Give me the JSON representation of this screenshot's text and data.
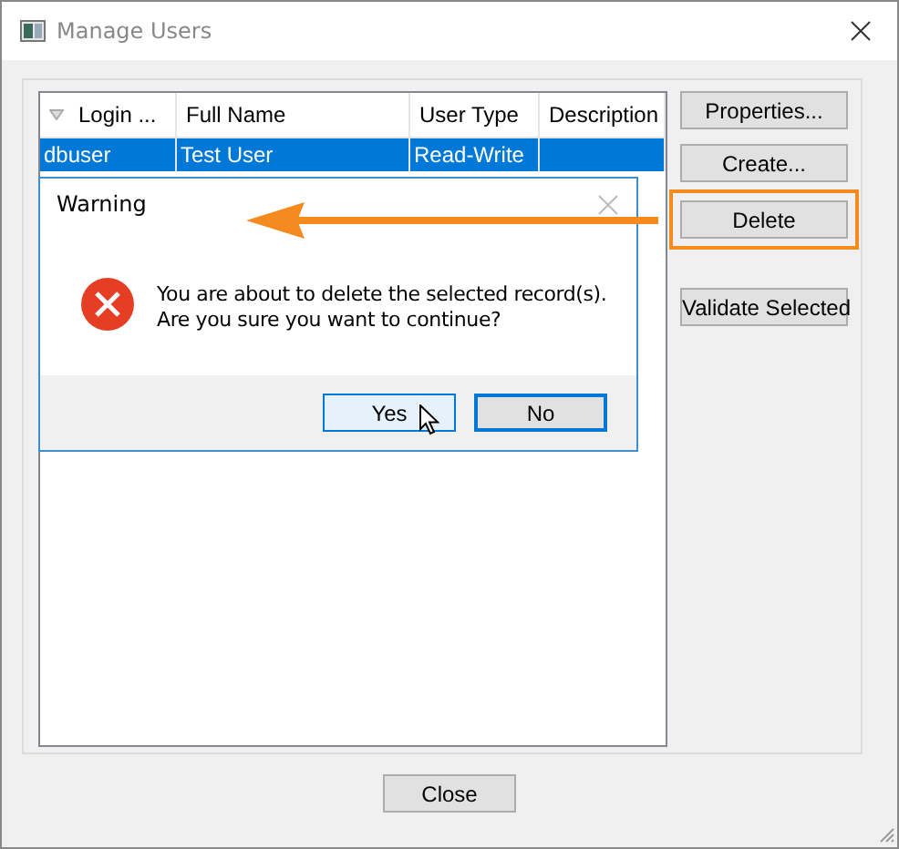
{
  "window": {
    "title": "Manage Users"
  },
  "table": {
    "columns": [
      {
        "label": "Login ...",
        "sort_icon": true
      },
      {
        "label": "Full Name",
        "sort_icon": false
      },
      {
        "label": "User Type",
        "sort_icon": false
      },
      {
        "label": "Description",
        "sort_icon": false
      }
    ],
    "rows": [
      {
        "cells": [
          "dbuser",
          "Test User",
          "Read-Write",
          ""
        ],
        "selected": true
      }
    ]
  },
  "buttons": [
    {
      "label": "Properties...",
      "highlighted": false
    },
    {
      "label": "Create...",
      "highlighted": false
    },
    {
      "label": "Delete",
      "highlighted": true
    },
    {
      "label": "Validate Selected",
      "highlighted": false
    }
  ],
  "close_button": "Close",
  "dialog": {
    "title": "Warning",
    "message": [
      "You are about to delete the selected record(s).",
      "Are you sure you want to continue?"
    ],
    "buttons": [
      {
        "label": "Yes",
        "hovered": true,
        "default": false
      },
      {
        "label": "No",
        "hovered": false,
        "default": true
      }
    ]
  }
}
